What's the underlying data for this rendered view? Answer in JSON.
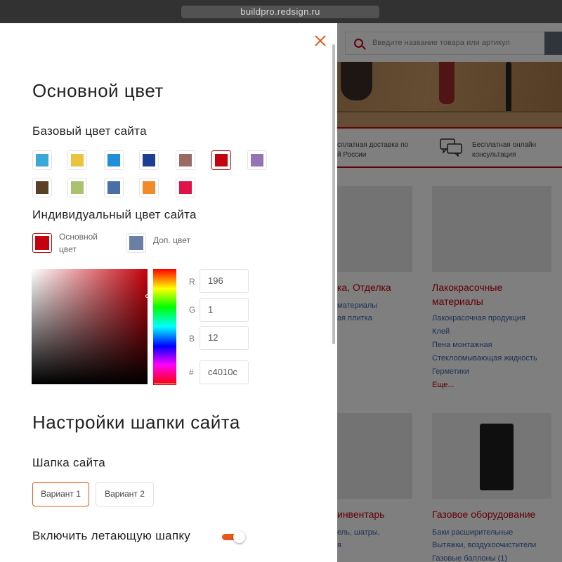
{
  "browser": {
    "url": "buildpro.redsign.ru"
  },
  "site": {
    "search_placeholder": "Введите название товара или артикул",
    "features": [
      {
        "text": "сплатная доставка по\nй России"
      },
      {
        "text": "Бесплатная онлайн\nконсультация"
      }
    ],
    "categories": [
      {
        "title": "ка, Отделка",
        "links": [
          "материалы",
          "ая плитка"
        ]
      },
      {
        "title": "Лакокрасочные\nматериалы",
        "links": [
          "Лакокрасочная продукция",
          "Клей",
          "Пена монтажная",
          "Стеклоомывающая жидкость",
          "Герметики"
        ],
        "more": "Еще..."
      },
      {
        "title": "инвентарь",
        "links": [
          "ель, шатры,",
          "я"
        ]
      },
      {
        "title": "Газовое оборудование",
        "links": [
          "Баки расширительные",
          "Вытяжки, воздухоочистители",
          "Газовые баллоны (1)"
        ]
      }
    ]
  },
  "panel": {
    "title": "Основной цвет",
    "base_color_label": "Базовый цвет сайта",
    "base_colors": [
      "#3aa8d8",
      "#eac33f",
      "#1e8fd8",
      "#1e3e92",
      "#9a6b62",
      "#c4010c",
      "#9474b4",
      "#5a4025",
      "#a9c26e",
      "#4a6ea8",
      "#f28a2c",
      "#e0124a"
    ],
    "active_color_index": 5,
    "indiv_label": "Индивидуальный цвет сайта",
    "indiv": {
      "main_label": "Основной\nцвет",
      "main_color": "#c4010c",
      "extra_label": "Доп. цвет",
      "extra_color": "#6a7ea6"
    },
    "rgb": {
      "r_label": "R",
      "r": "196",
      "g_label": "G",
      "g": "1",
      "b_label": "B",
      "b": "12",
      "hex_label": "#",
      "hex": "c4010c"
    },
    "header_title": "Настройки шапки сайта",
    "header_label": "Шапка сайта",
    "variants": [
      "Вариант 1",
      "Вариант 2"
    ],
    "flying_header_label": "Включить летающую шапку",
    "flying_header_on": true
  }
}
